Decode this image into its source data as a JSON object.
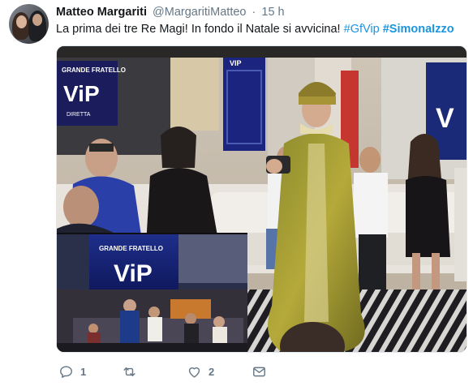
{
  "author": {
    "name": "Matteo Margariti",
    "handle": "@MargaritiMatteo",
    "separator": "·",
    "time": "15 h"
  },
  "tweet": {
    "text": "La prima dei tre Re Magi! In fondo il Natale si avvicina! ",
    "hashtags": [
      "#GfVip",
      "#SimonaIzzo"
    ]
  },
  "media": {
    "sign_top_left": "GRANDE FRATELLO",
    "logo_top_left": "ViP",
    "sign_top_left_sub": "DIRETTA",
    "sign_center": "VIP",
    "logo_screen": "ViP",
    "logo_screen_top": "GRANDE FRATELLO",
    "logo_right": "V"
  },
  "actions": {
    "reply_count": "1",
    "retweet_count": "",
    "like_count": "2"
  },
  "colors": {
    "link": "#1b95e0",
    "secondary_text": "#657786"
  }
}
